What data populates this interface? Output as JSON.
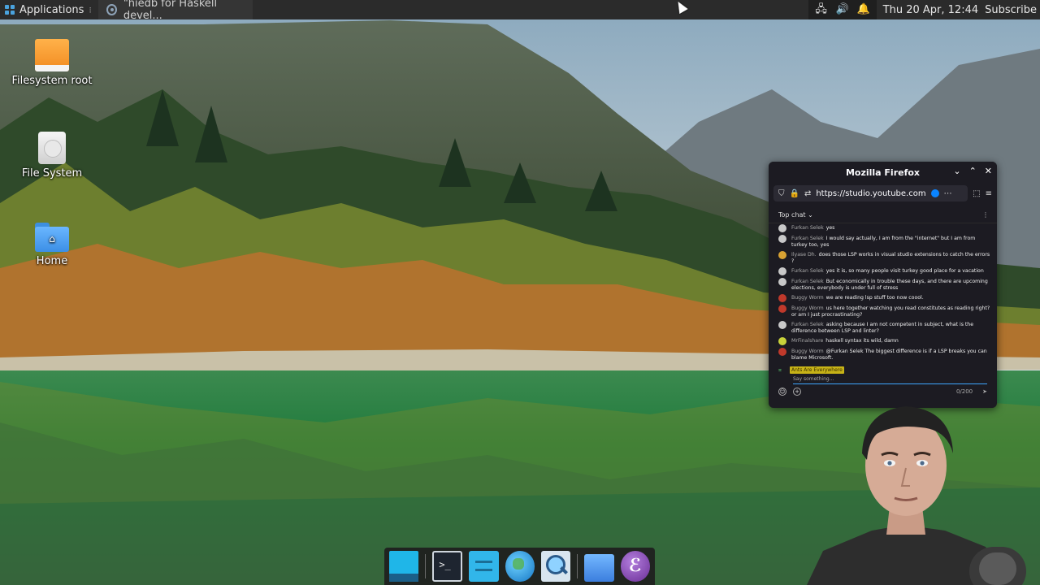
{
  "top_panel": {
    "applications_label": "Applications",
    "task_label": "\"hiedb for Haskell devel...",
    "clock": "Thu 20 Apr, 12:44",
    "subscribe_label": "Subscribe"
  },
  "desktop": {
    "icons": [
      {
        "label": "Filesystem root",
        "icon": "drive-icon"
      },
      {
        "label": "File System",
        "icon": "disk-icon"
      },
      {
        "label": "Home",
        "icon": "home-folder-icon"
      }
    ]
  },
  "firefox": {
    "title": "Mozilla Firefox",
    "url": "https://studio.youtube.com",
    "chat_mode": "Top chat",
    "messages": [
      {
        "author": "Furkan Selek",
        "text": "yes",
        "avatar": "grey"
      },
      {
        "author": "Furkan Selek",
        "text": "I would say actually, I am from the \"internet\" but I am from turkey too, yes",
        "avatar": "grey"
      },
      {
        "author": "Ilyase Dh.",
        "text": "does those LSP works in visual studio extensions to catch the errors ?",
        "avatar": "gold"
      },
      {
        "author": "Furkan Selek",
        "text": "yes it is, so many people visit turkey good place for a vacation",
        "avatar": "grey"
      },
      {
        "author": "Furkan Selek",
        "text": "But economically in trouble these days, and there are upcoming elections, everybody is under full of stress",
        "avatar": "grey"
      },
      {
        "author": "Buggy Worm",
        "text": "we are reading lsp stuff too now coool.",
        "avatar": "red"
      },
      {
        "author": "Buggy Worm",
        "text": "us here together watching you read constitutes as reading right? or am I just procrastinating?",
        "avatar": "red"
      },
      {
        "author": "Furkan Selek",
        "text": "asking because I am not competent in subject, what is the difference between LSP and linter?",
        "avatar": "grey"
      },
      {
        "author": "MrFinalshare",
        "text": "haskell syntax its wild, damn",
        "avatar": "yellow"
      },
      {
        "author": "Buggy Worm",
        "text": "@Furkan Selek The biggest difference is if a LSP breaks you can blame Microsoft.",
        "avatar": "red"
      }
    ],
    "member_name": "Ants Are Everywhere",
    "input_placeholder": "Say something...",
    "char_count": "0/200"
  },
  "colors": {
    "panel_bg": "#2b2b2b",
    "firefox_bg": "#1c1b22",
    "accent_blue": "#0a84ff",
    "member_badge_bg": "#c7b317"
  }
}
